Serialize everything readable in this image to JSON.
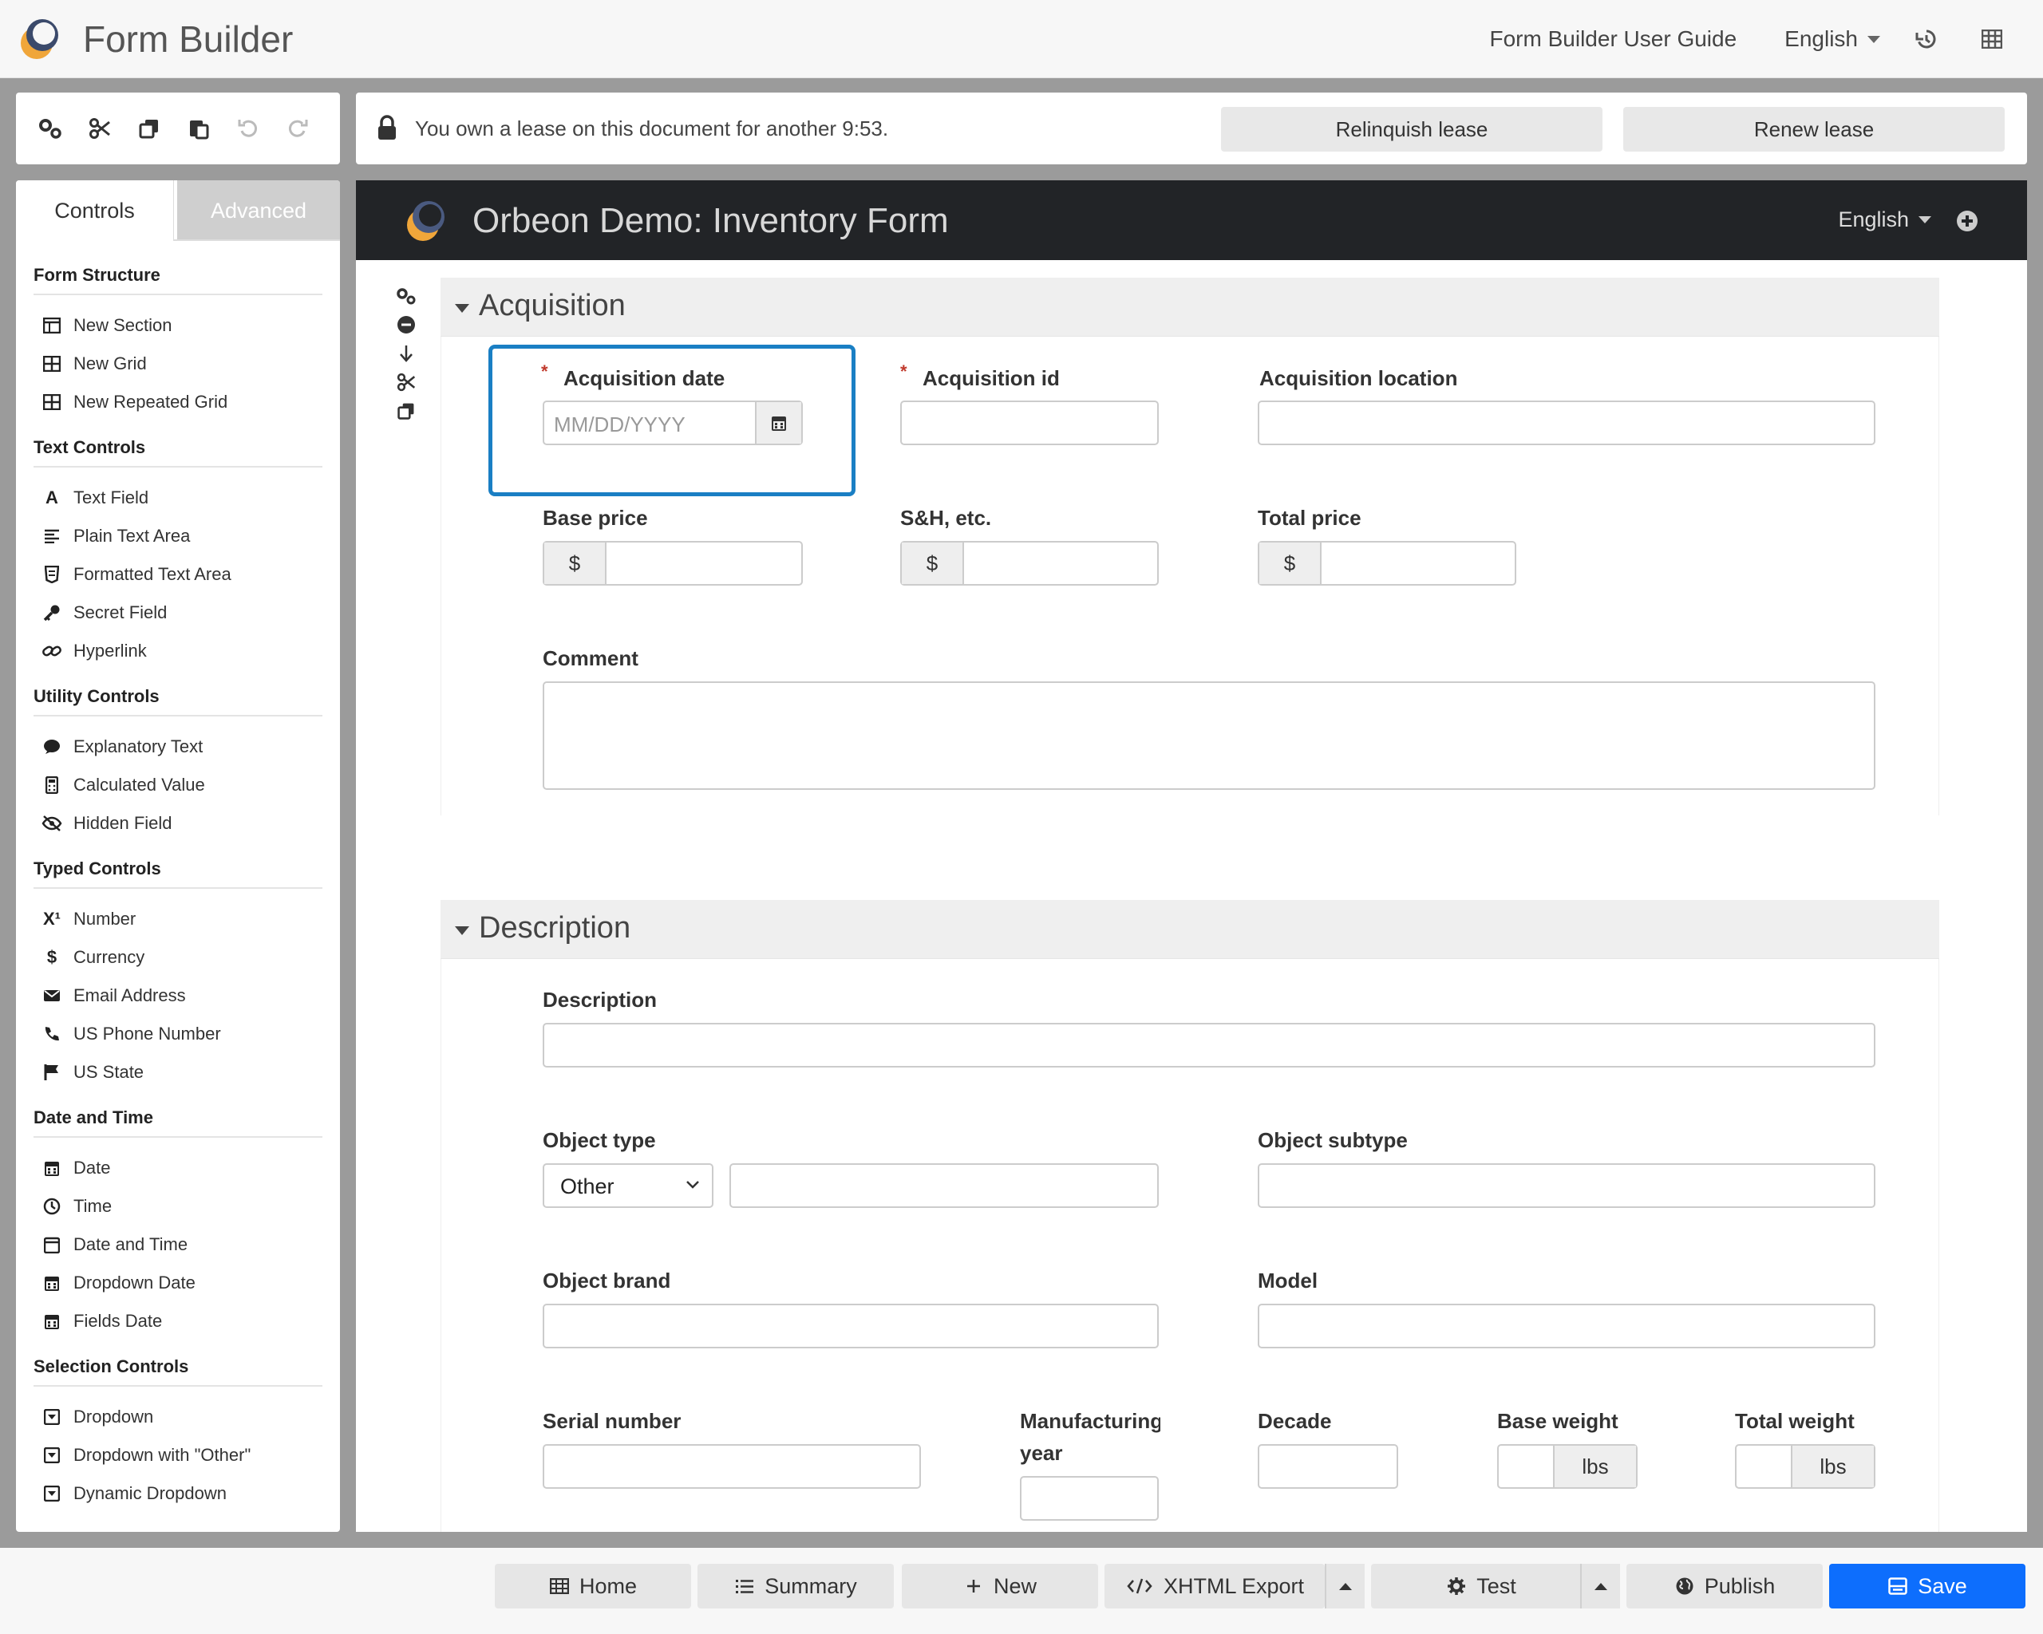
{
  "app": {
    "title": "Form Builder",
    "user_guide_link": "Form Builder User Guide",
    "language": "English"
  },
  "lease": {
    "message": "You own a lease on this document for another 9:53.",
    "relinquish_label": "Relinquish lease",
    "renew_label": "Renew lease"
  },
  "sidebar": {
    "tabs": [
      "Controls",
      "Advanced"
    ],
    "categories": [
      {
        "title": "Form Structure",
        "items": [
          "New Section",
          "New Grid",
          "New Repeated Grid"
        ]
      },
      {
        "title": "Text Controls",
        "items": [
          "Text Field",
          "Plain Text Area",
          "Formatted Text Area",
          "Secret Field",
          "Hyperlink"
        ]
      },
      {
        "title": "Utility Controls",
        "items": [
          "Explanatory Text",
          "Calculated Value",
          "Hidden Field"
        ]
      },
      {
        "title": "Typed Controls",
        "items": [
          "Number",
          "Currency",
          "Email Address",
          "US Phone Number",
          "US State"
        ]
      },
      {
        "title": "Date and Time",
        "items": [
          "Date",
          "Time",
          "Date and Time",
          "Dropdown Date",
          "Fields Date"
        ]
      },
      {
        "title": "Selection Controls",
        "items": [
          "Dropdown",
          "Dropdown with \"Other\"",
          "Dynamic Dropdown"
        ]
      }
    ]
  },
  "form": {
    "title": "Orbeon Demo: Inventory Form",
    "language": "English",
    "sections": [
      {
        "title": "Acquisition",
        "fields": {
          "acquisition_date": {
            "label": "Acquisition date",
            "placeholder": "MM/DD/YYYY"
          },
          "acquisition_id": {
            "label": "Acquisition id"
          },
          "acquisition_location": {
            "label": "Acquisition location"
          },
          "base_price": {
            "label": "Base price",
            "prefix": "$"
          },
          "sh_etc": {
            "label": "S&H, etc.",
            "prefix": "$"
          },
          "total_price": {
            "label": "Total price",
            "prefix": "$"
          },
          "comment": {
            "label": "Comment"
          }
        }
      },
      {
        "title": "Description",
        "fields": {
          "description": {
            "label": "Description"
          },
          "object_type": {
            "label": "Object type",
            "selected": "Other"
          },
          "object_subtype": {
            "label": "Object subtype"
          },
          "object_brand": {
            "label": "Object brand"
          },
          "model": {
            "label": "Model"
          },
          "serial_number": {
            "label": "Serial number"
          },
          "manufacturing_year": {
            "label_line1": "Manufacturing",
            "label_line2": "year"
          },
          "decade": {
            "label": "Decade"
          },
          "base_weight": {
            "label": "Base weight",
            "suffix": "lbs"
          },
          "total_weight": {
            "label": "Total weight",
            "suffix": "lbs"
          }
        }
      }
    ]
  },
  "bottombar": {
    "home": "Home",
    "summary": "Summary",
    "new": "New",
    "xhtml_export": "XHTML Export",
    "test": "Test",
    "publish": "Publish",
    "save": "Save"
  },
  "colors": {
    "accent_blue": "#0d6efd",
    "highlight_border": "#1a7fc4",
    "required_star": "#c0392b",
    "form_header_bg": "#222427"
  }
}
